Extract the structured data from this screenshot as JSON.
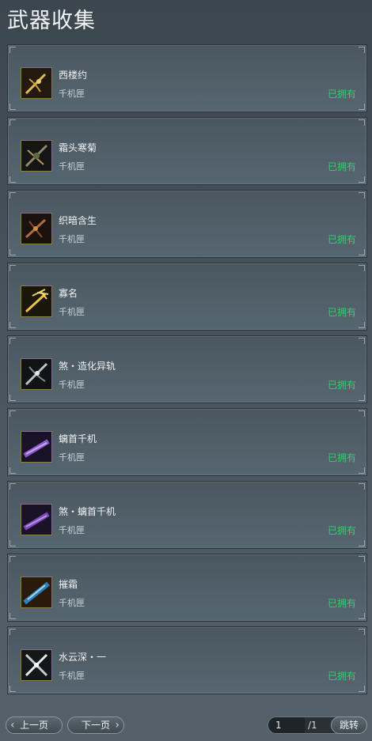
{
  "header": {
    "title": "武器收集"
  },
  "items": [
    {
      "name": "西楼约",
      "type": "千机匣",
      "status": "已拥有",
      "icon": "golden-crossbow-icon"
    },
    {
      "name": "霜头寒菊",
      "type": "千机匣",
      "status": "已拥有",
      "icon": "dark-crossbow-icon"
    },
    {
      "name": "织暗含生",
      "type": "千机匣",
      "status": "已拥有",
      "icon": "bronze-crossbow-icon"
    },
    {
      "name": "寡名",
      "type": "千机匣",
      "status": "已拥有",
      "icon": "golden-trident-crossbow-icon"
    },
    {
      "name": "煞・造化异轨",
      "type": "千机匣",
      "status": "已拥有",
      "icon": "silver-crossbow-icon"
    },
    {
      "name": "螭首千机",
      "type": "千机匣",
      "status": "已拥有",
      "icon": "purple-gun-crossbow-icon"
    },
    {
      "name": "煞・螭首千机",
      "type": "千机匣",
      "status": "已拥有",
      "icon": "purple-gun-crossbow-icon"
    },
    {
      "name": "摧霜",
      "type": "千机匣",
      "status": "已拥有",
      "icon": "blue-crystal-crossbow-icon"
    },
    {
      "name": "水云深・一",
      "type": "千机匣",
      "status": "已拥有",
      "icon": "white-crossed-crossbow-icon"
    }
  ],
  "pager": {
    "prev_label": "上一页",
    "next_label": "下一页",
    "current_page": "1",
    "total_label": "/1",
    "jump_label": "跳转"
  },
  "colors": {
    "owned": "#2fd06a",
    "icon_border": "#8a7a4a"
  }
}
